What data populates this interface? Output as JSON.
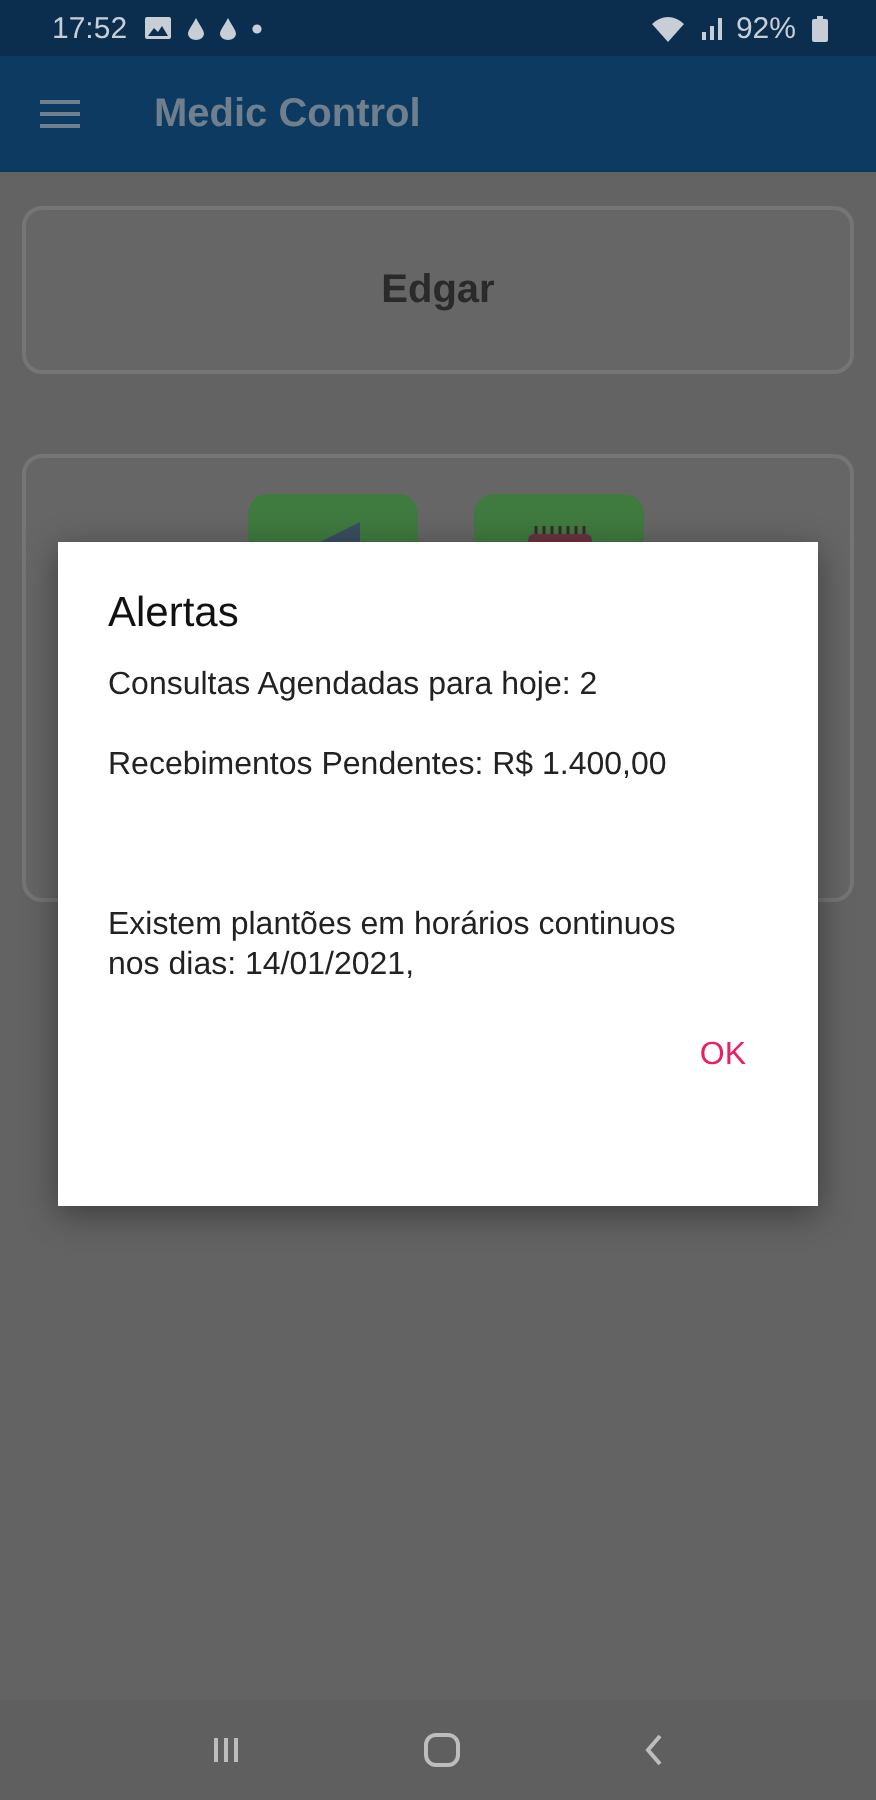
{
  "status_bar": {
    "time": "17:52",
    "battery": "92%"
  },
  "app_bar": {
    "title": "Medic Control"
  },
  "user_card": {
    "name": "Edgar"
  },
  "dialog": {
    "title": "Alertas",
    "messages": [
      {
        "text": "Consultas Agendadas para hoje: 2"
      },
      {
        "text": "Recebimentos Pendentes: R$ 1.400,00"
      },
      {
        "text": "Existem plantões em horários continuos nos dias: 14/01/2021,"
      }
    ],
    "button": "OK"
  }
}
